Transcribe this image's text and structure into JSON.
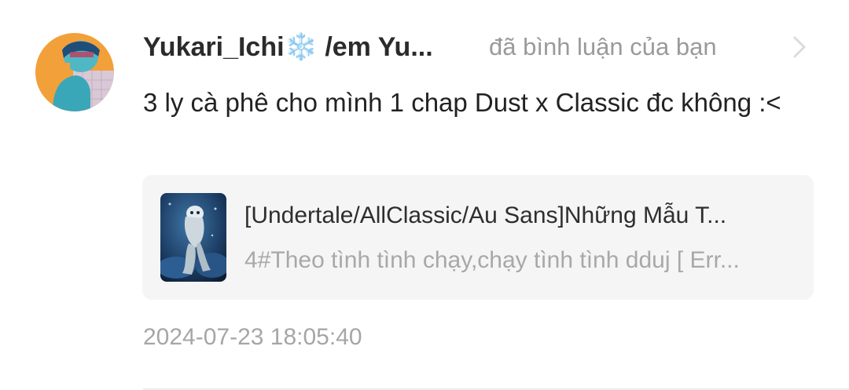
{
  "notification": {
    "username": "Yukari_Ichi❄️ /em Yu...",
    "action": "đã bình luận của bạn",
    "comment": "3 ly cà phê cho mình 1 chap Dust x Classic đc không :<",
    "story": {
      "title": "[Undertale/AllClassic/Au Sans]Những Mẫu T...",
      "chapter": "4#Theo tình tình chạy,chạy tình tình dduj [ Err..."
    },
    "timestamp": "2024-07-23 18:05:40"
  },
  "icons": {
    "avatar": "user-avatar-image",
    "chevron": "chevron-right-icon",
    "cover": "story-cover-image"
  },
  "colors": {
    "username": "#2b2b2b",
    "secondary_text": "#9a9a9a",
    "card_background": "#f5f5f6",
    "avatar_orange": "#f2a03a",
    "avatar_teal": "#3aa7b8"
  }
}
